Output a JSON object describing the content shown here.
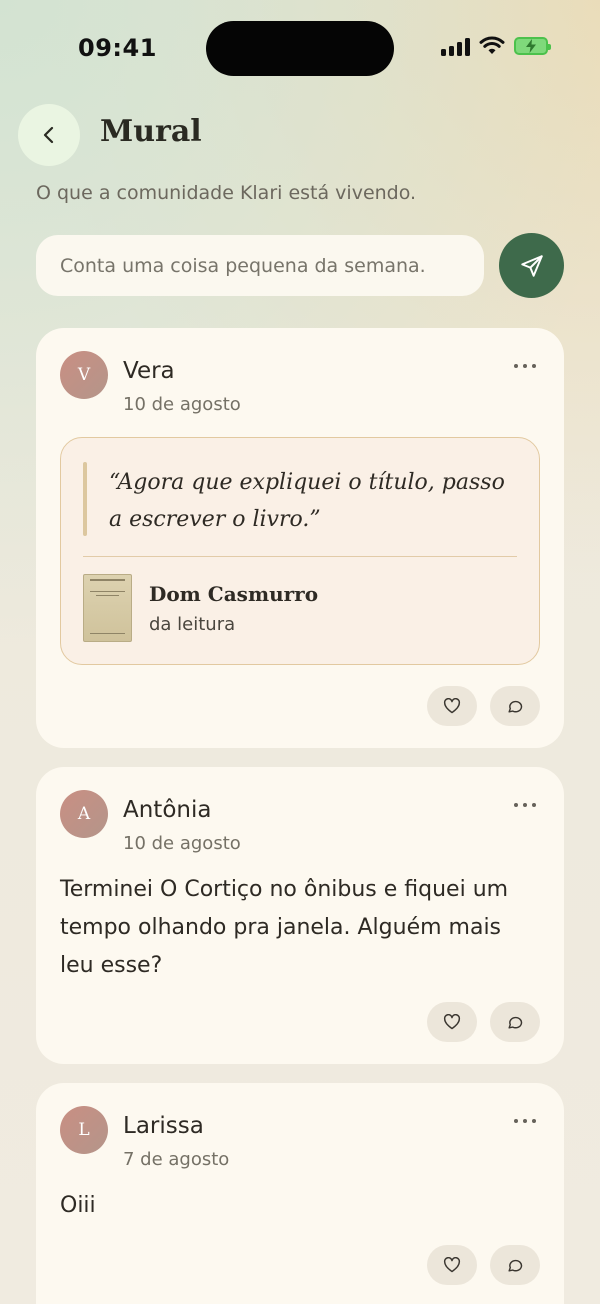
{
  "status_bar": {
    "time": "09:41"
  },
  "header": {
    "title": "Mural",
    "subtitle": "O que a comunidade Klari está vivendo."
  },
  "composer": {
    "placeholder": "Conta uma coisa pequena da semana."
  },
  "posts": [
    {
      "initial": "V",
      "author": "Vera",
      "date": "10 de agosto",
      "quote": {
        "text": "“Agora que expliquei o título, passo a escrever o livro.”",
        "book_title": "Dom Casmurro",
        "book_subtitle": "da leitura"
      }
    },
    {
      "initial": "A",
      "author": "Antônia",
      "date": "10 de agosto",
      "text": "Terminei O Cortiço no ônibus e fiquei um tempo olhando pra janela. Alguém mais leu esse?"
    },
    {
      "initial": "L",
      "author": "Larissa",
      "date": "7 de agosto",
      "text": "Oiii"
    }
  ],
  "colors": {
    "accent": "#3e6a4b",
    "card": "#fdf9f0",
    "quote_border": "#e2c9a0"
  },
  "icons": [
    "back-chevron-icon",
    "send-icon",
    "more-icon",
    "heart-icon",
    "comment-icon",
    "signal-icon",
    "wifi-icon",
    "battery-icon"
  ]
}
